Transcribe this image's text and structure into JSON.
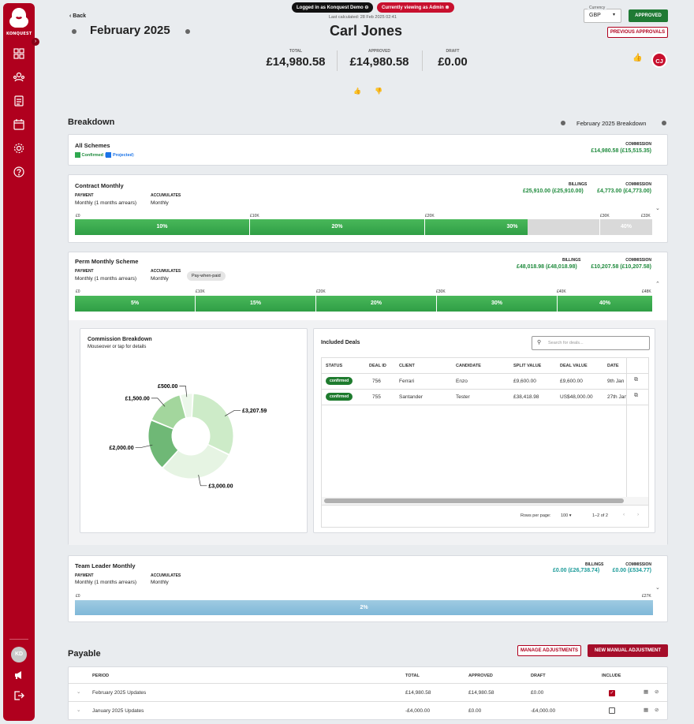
{
  "sidebar": {
    "logo_text": "KONQUEST",
    "user_initials": "KD"
  },
  "header": {
    "back": "Back",
    "period": "February 2025",
    "logged_in": "Logged in as Konquest Demo",
    "viewing_as": "Currently viewing as Admin",
    "last_calculated": "Last calculated: 28 Feb 2025 02:41",
    "person": "Carl Jones",
    "currency_label": "Currency",
    "currency_value": "GBP",
    "approved_btn": "APPROVED",
    "previous_approvals": "PREVIOUS APPROVALS",
    "avatar": "CJ"
  },
  "totals": {
    "total_label": "TOTAL",
    "total": "£14,980.58",
    "approved_label": "APPROVED",
    "approved": "£14,980.58",
    "draft_label": "DRAFT",
    "draft": "£0.00"
  },
  "breakdown": {
    "title": "Breakdown",
    "period_label": "February 2025 Breakdown",
    "all_schemes": {
      "title": "All Schemes",
      "confirmed": "Confirmed",
      "projected": "Projected",
      "commission_label": "COMMISSION",
      "commission": "£14,980.58 (£15,515.35)",
      "colors": {
        "confirmed": "#2fa84f",
        "projected": "#1a73e8"
      }
    },
    "contract": {
      "title": "Contract Monthly",
      "payment_label": "PAYMENT",
      "payment": "Monthly (1 months arrears)",
      "accumulates_label": "ACCUMULATES",
      "accumulates": "Monthly",
      "billings_label": "BILLINGS",
      "billings": "£25,910.00 (£25,910.00)",
      "commission_label": "COMMISSION",
      "commission": "£4,773.00 (£4,773.00)",
      "ticks": [
        "£0",
        "£10K",
        "£20K",
        "£30K",
        "£33K"
      ],
      "tiers": [
        {
          "label": "10%",
          "filled": 1
        },
        {
          "label": "20%",
          "filled": 1
        },
        {
          "label": "30%",
          "filled": 0.59
        },
        {
          "label": "40%",
          "filled": 0
        }
      ]
    },
    "perm": {
      "title": "Perm Monthly Scheme",
      "payment_label": "PAYMENT",
      "payment": "Monthly (1 months arrears)",
      "accumulates_label": "ACCUMULATES",
      "accumulates": "Monthly",
      "pay_when_paid": "Pay-when-paid",
      "billings_label": "BILLINGS",
      "billings": "£48,018.98 (£48,018.98)",
      "commission_label": "COMMISSION",
      "commission": "£10,207.58 (£10,207.58)",
      "ticks": [
        "£0",
        "£10K",
        "£20K",
        "£30K",
        "£40K",
        "£48K"
      ],
      "tiers": [
        "5%",
        "15%",
        "20%",
        "30%",
        "40%"
      ]
    },
    "commission_breakdown": {
      "title": "Commission Breakdown",
      "subtitle": "Mouseover or tap for details"
    },
    "deals": {
      "title": "Included Deals",
      "search_placeholder": "Search for deals...",
      "columns": [
        "STATUS",
        "DEAL ID",
        "CLIENT",
        "CANDIDATE",
        "SPLIT VALUE",
        "DEAL VALUE",
        "DATE"
      ],
      "rows": [
        {
          "status": "confirmed",
          "id": "756",
          "client": "Ferrari",
          "candidate": "Enzo",
          "split": "£9,600.00",
          "value": "£9,600.00",
          "date": "9th Jan"
        },
        {
          "status": "confirmed",
          "id": "755",
          "client": "Santander",
          "candidate": "Tester",
          "split": "£38,418.98",
          "value": "US$48,000.00",
          "date": "27th Jan"
        }
      ],
      "rows_per_page_label": "Rows per page:",
      "rows_per_page": "100",
      "range": "1–2 of 2"
    },
    "team": {
      "title": "Team Leader Monthly",
      "payment_label": "PAYMENT",
      "payment": "Monthly (1 months arrears)",
      "accumulates_label": "ACCUMULATES",
      "accumulates": "Monthly",
      "billings_label": "BILLINGS",
      "billings": "£0.00 (£26,738.74)",
      "commission_label": "COMMISSION",
      "commission": "£0.00 (£534.77)",
      "ticks": [
        "£0",
        "£27K"
      ],
      "tier": "2%"
    }
  },
  "chart_data": {
    "type": "pie",
    "title": "Commission Breakdown",
    "categories": [
      "£3,207.59",
      "£3,000.00",
      "£2,000.00",
      "£1,500.00",
      "£500.00"
    ],
    "values": [
      3207.59,
      3000.0,
      2000.0,
      1500.0,
      500.0
    ],
    "colors": [
      "#cdebc8",
      "#e6f4e3",
      "#6fb876",
      "#a3d69d",
      "#ecf7ea"
    ]
  },
  "payable": {
    "title": "Payable",
    "manage_btn": "MANAGE ADJUSTMENTS",
    "new_btn": "NEW MANUAL ADJUSTMENT",
    "columns": [
      "PERIOD",
      "TOTAL",
      "APPROVED",
      "DRAFT",
      "INCLUDE"
    ],
    "rows": [
      {
        "period": "February 2025 Updates",
        "total": "£14,980.58",
        "approved": "£14,980.58",
        "draft": "£0.00",
        "include": true
      },
      {
        "period": "January 2025 Updates",
        "total": "-£4,000.00",
        "approved": "£0.00",
        "draft": "-£4,000.00",
        "include": false
      }
    ]
  }
}
